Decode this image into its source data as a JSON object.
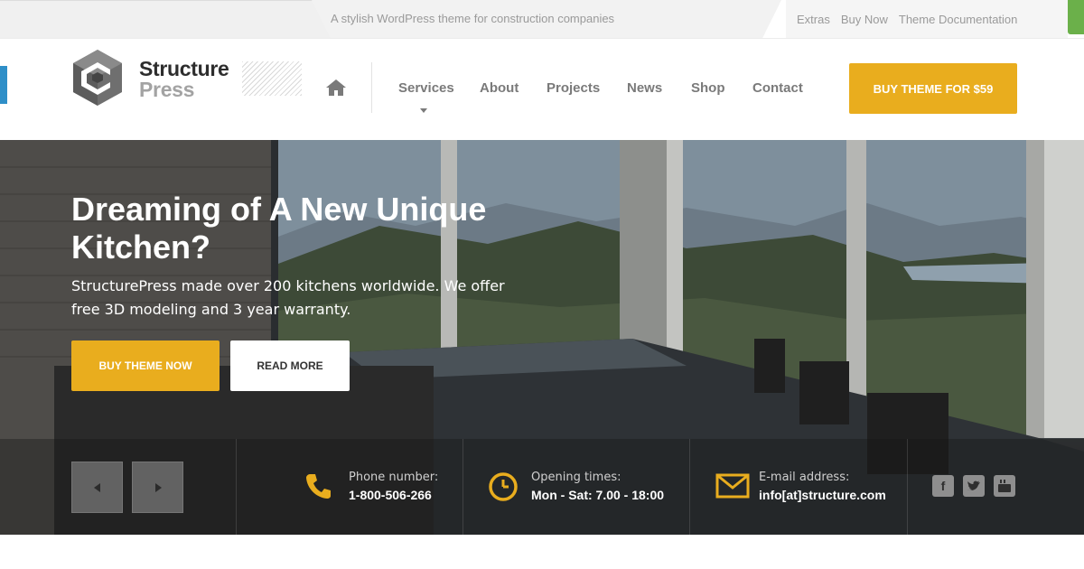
{
  "topbar": {
    "tagline": "A stylish WordPress theme for construction companies",
    "links": [
      "Extras",
      "Buy Now",
      "Theme Documentation"
    ]
  },
  "logo": {
    "line1": "Structure",
    "line2": "Press"
  },
  "nav": {
    "home_icon": "home-icon",
    "items": [
      "Services",
      "About",
      "Projects",
      "News",
      "Shop",
      "Contact"
    ],
    "cta": "BUY THEME FOR $59"
  },
  "hero": {
    "title": "Dreaming of A New Unique Kitchen?",
    "text": "StructurePress made over 200 kitchens worldwide. We offer free 3D modeling and 3 year warranty.",
    "primary_button": "BUY THEME NOW",
    "secondary_button": "READ MORE"
  },
  "info": {
    "phone": {
      "label": "Phone number:",
      "value": "1-800-506-266",
      "icon": "phone-icon"
    },
    "hours": {
      "label": "Opening times:",
      "value": "Mon - Sat: 7.00 - 18:00",
      "icon": "clock-icon"
    },
    "email": {
      "label": "E-mail address:",
      "value": "info[at]structure.com",
      "icon": "envelope-icon"
    }
  },
  "social": [
    "facebook-icon",
    "twitter-icon",
    "youtube-icon"
  ],
  "colors": {
    "accent": "#e9ad1e",
    "text_dark": "#2d2d2d",
    "muted": "#9a9a9a"
  }
}
